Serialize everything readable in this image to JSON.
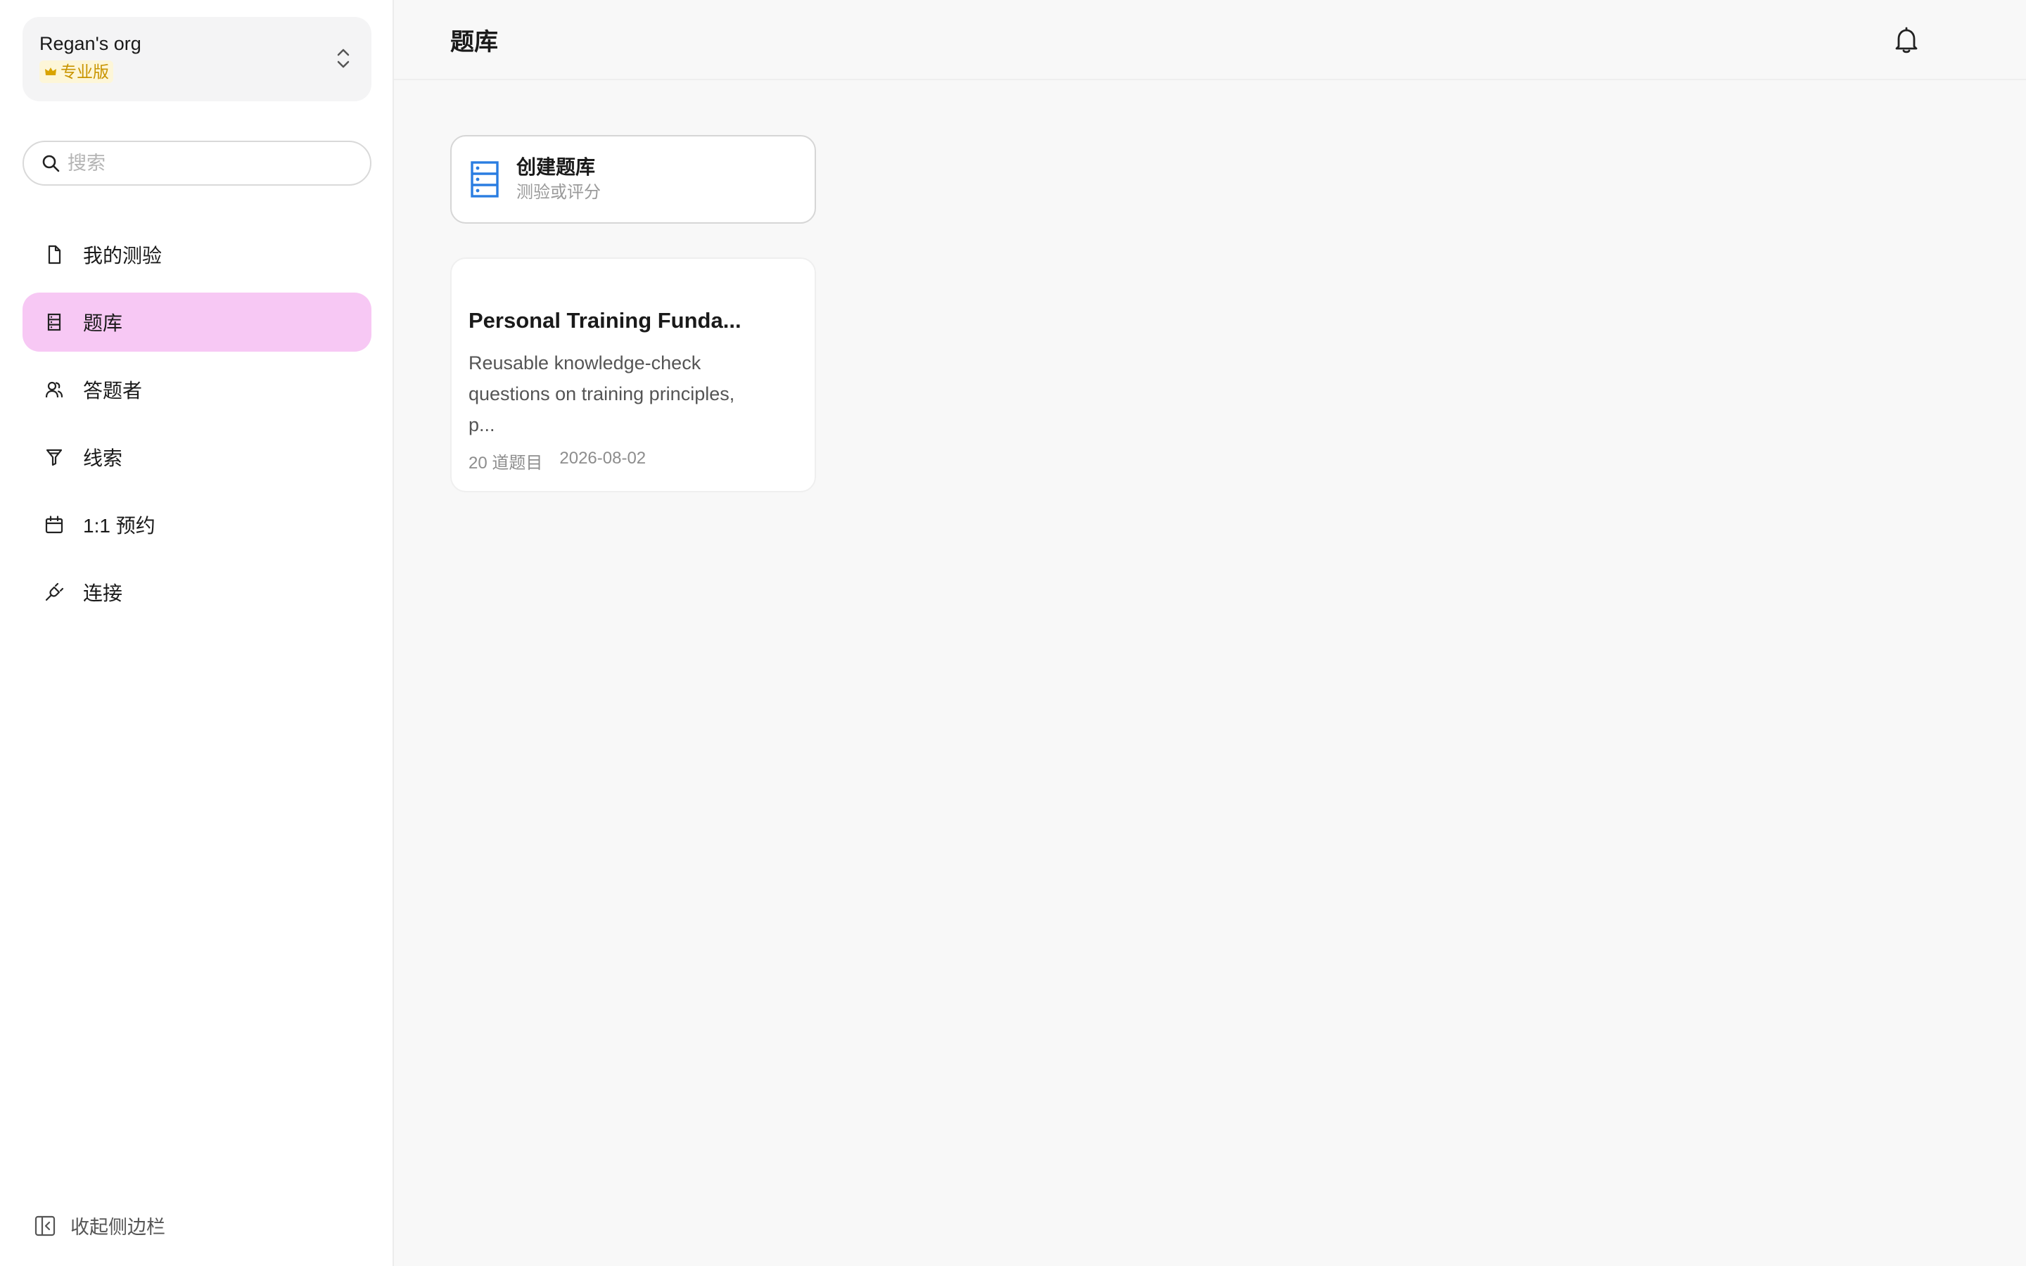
{
  "org": {
    "name": "Regan's org",
    "plan": "专业版"
  },
  "search": {
    "placeholder": "搜索",
    "value": ""
  },
  "nav": {
    "items": [
      {
        "label": "我的测验",
        "icon": "file-icon"
      },
      {
        "label": "题库",
        "icon": "database-icon",
        "active": true
      },
      {
        "label": "答题者",
        "icon": "users-icon"
      },
      {
        "label": "线索",
        "icon": "filter-icon"
      },
      {
        "label": "1:1 预约",
        "icon": "calendar-icon"
      },
      {
        "label": "连接",
        "icon": "plug-icon"
      }
    ]
  },
  "sidebar": {
    "collapse_label": "收起侧边栏"
  },
  "header": {
    "title": "题库"
  },
  "create_card": {
    "title": "创建题库",
    "subtitle": "测验或评分"
  },
  "question_banks": [
    {
      "title": "Personal Training Funda...",
      "description": "Reusable knowledge-check questions on training principles, p...",
      "count": "20 道题目",
      "date": "2026-08-02"
    }
  ],
  "colors": {
    "active_nav": "#f7c8f4",
    "accent_blue": "#2a7de1",
    "plan_gold": "#c99400"
  }
}
